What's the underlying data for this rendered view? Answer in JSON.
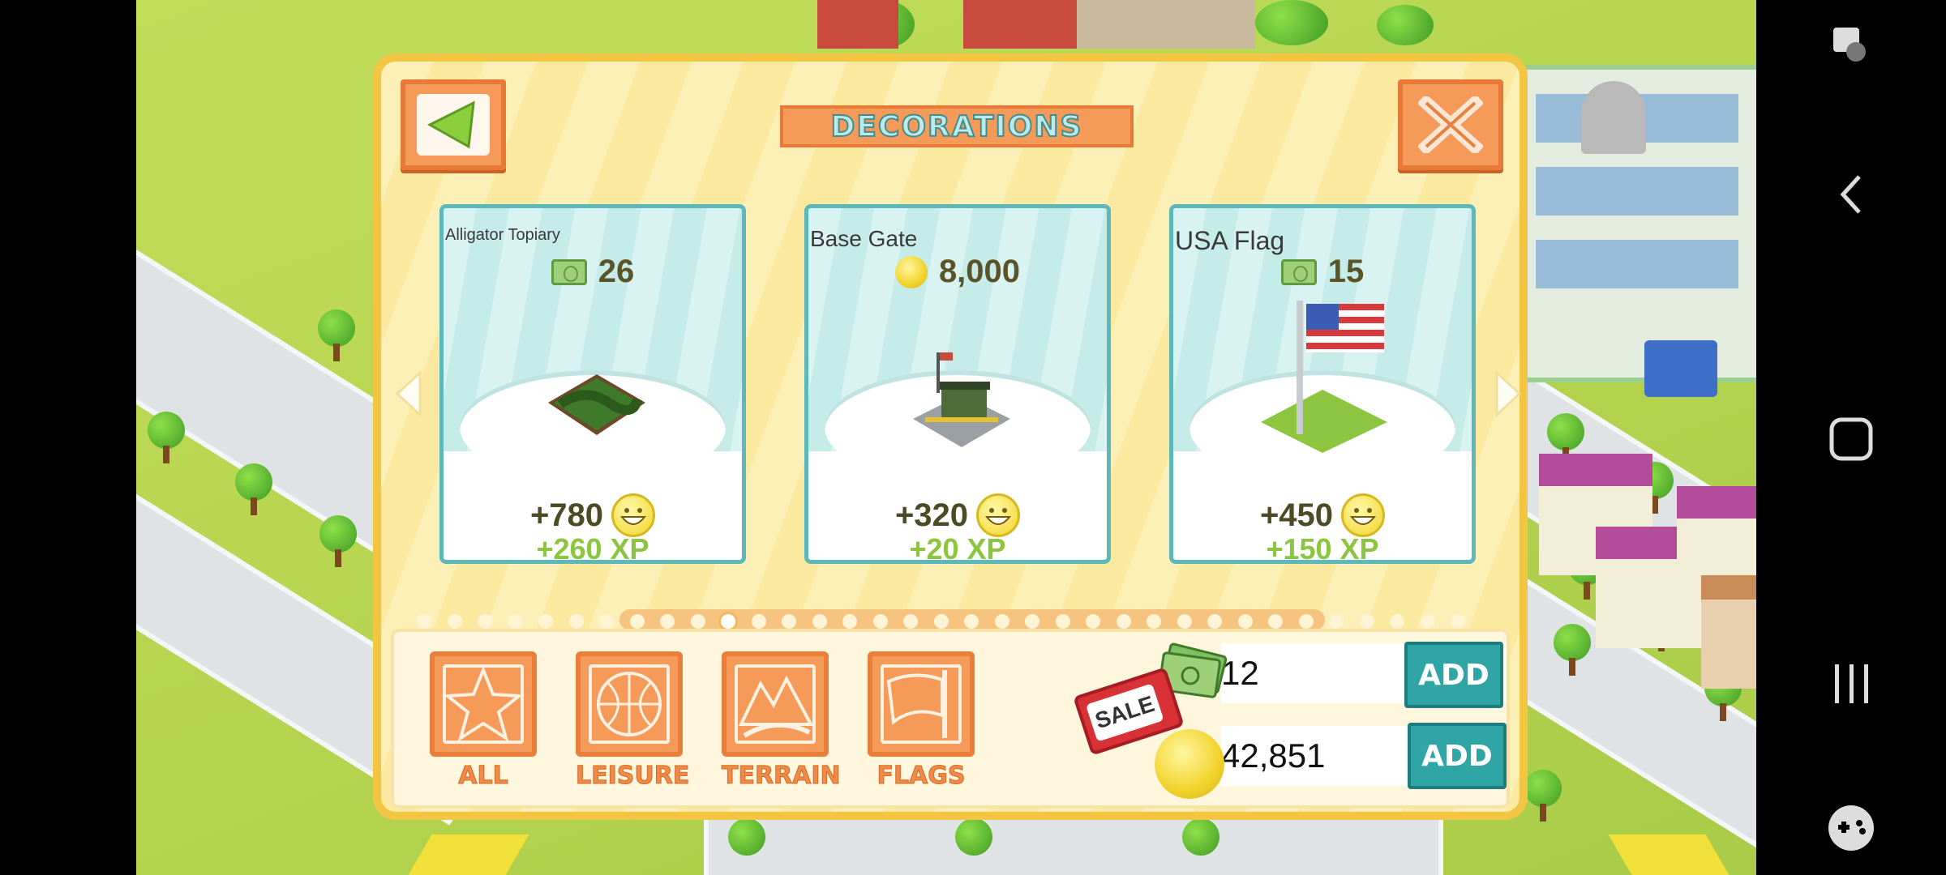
{
  "panel": {
    "title": "DECORATIONS"
  },
  "items": [
    {
      "name": "Alligator Topiary",
      "price": "26",
      "currency": "cash",
      "happiness": "+780",
      "xp": "+260 XP"
    },
    {
      "name": "Base Gate",
      "price": "8,000",
      "currency": "coins",
      "happiness": "+320",
      "xp": "+20 XP"
    },
    {
      "name": "USA Flag",
      "price": "15",
      "currency": "cash",
      "happiness": "+450",
      "xp": "+150 XP"
    }
  ],
  "pagination": {
    "total": 35,
    "active": 10
  },
  "categories": [
    {
      "label": "ALL",
      "icon": "star-icon"
    },
    {
      "label": "LEISURE",
      "icon": "basketball-icon"
    },
    {
      "label": "TERRAIN",
      "icon": "terrain-icon"
    },
    {
      "label": "FLAGS",
      "icon": "flag-icon"
    }
  ],
  "resources": {
    "cash": "12",
    "coins": "42,851",
    "add_label": "ADD",
    "sale_label": "SALE"
  },
  "icons": {
    "back": "back-arrow-icon",
    "close": "close-icon",
    "prev": "prev-page-icon",
    "next": "next-page-icon"
  },
  "system_nav": [
    "screenshot-icon",
    "back-icon",
    "home-icon",
    "recents-icon",
    "game-launcher-icon"
  ]
}
